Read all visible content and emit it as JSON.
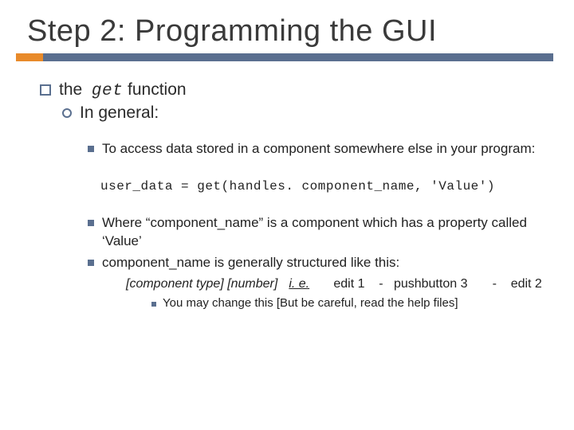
{
  "title": "Step 2: Programming the GUI",
  "l1": {
    "pre": "the ",
    "fn": "get",
    "post": "    function"
  },
  "l2": "In general:",
  "l3a": "To access data stored in a component somewhere else in your program:",
  "code": "user_data = get(handles. component_name, 'Value')",
  "l3b": "Where “component_name” is a component which has a property called ‘Value’",
  "l3c": "component_name is generally structured like this:",
  "l4": {
    "format": "[component type] [number]",
    "ie": "i. e.",
    "examples": "     edit 1    -   pushbutton 3       -    edit 2"
  },
  "l5": "You may change this [But be careful, read the help files]"
}
